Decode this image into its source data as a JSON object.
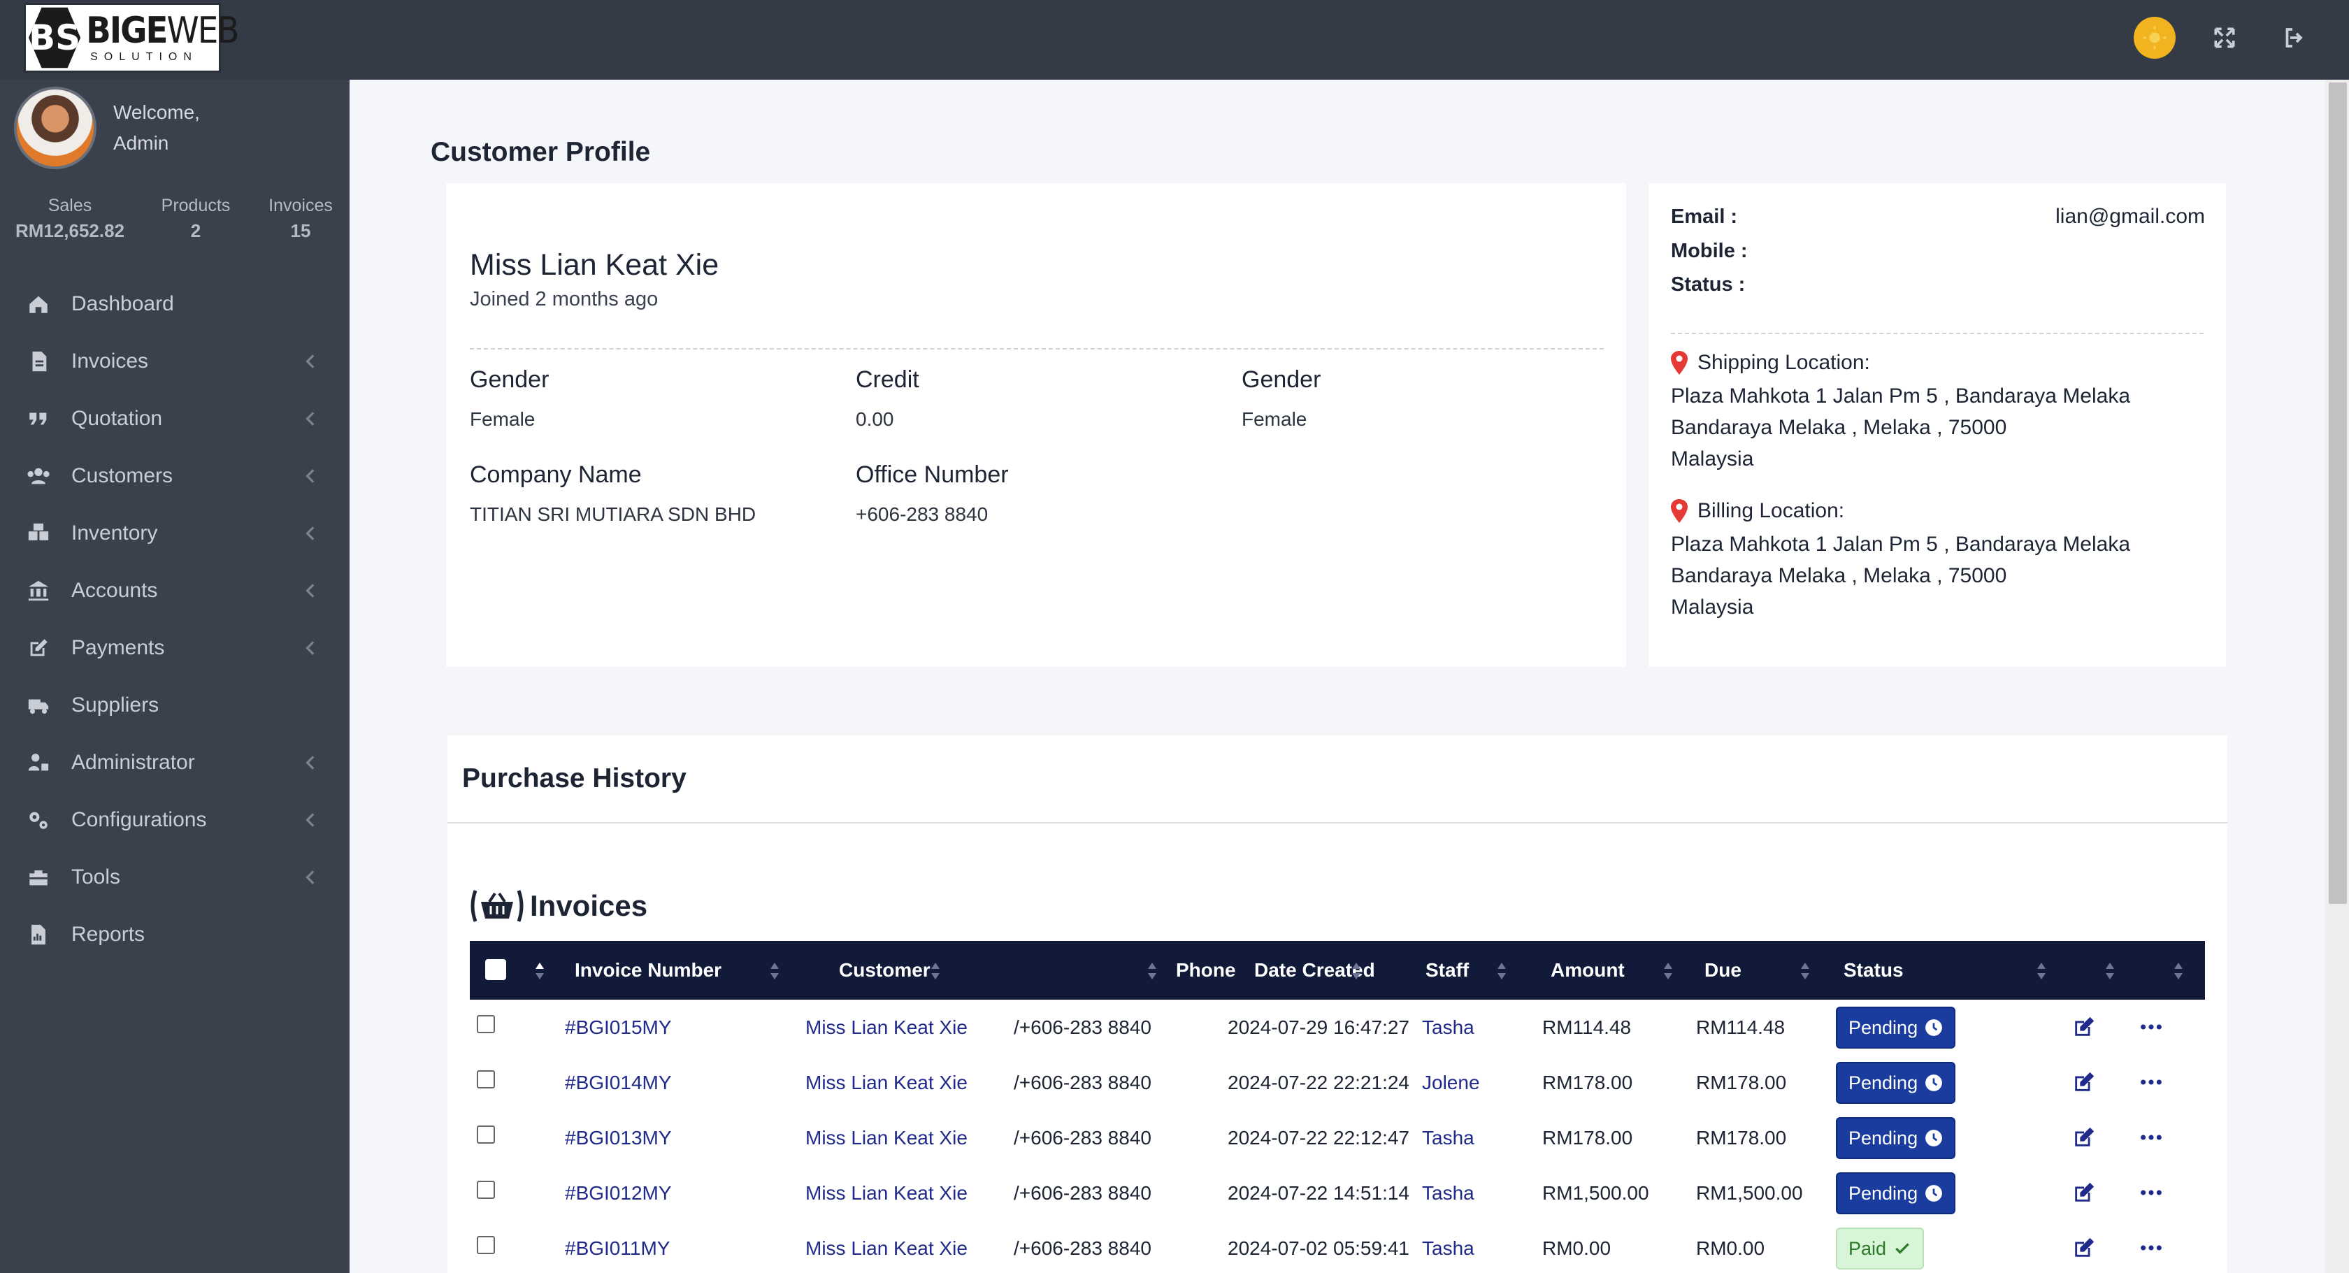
{
  "header": {
    "logo_mark": "BS",
    "logo_brand_bold": "BIGE",
    "logo_brand_light": "WEB",
    "logo_sub": "SOLUTION"
  },
  "user": {
    "welcome": "Welcome,",
    "name": "Admin"
  },
  "stats": [
    {
      "label": "Sales",
      "value": "RM12,652.82"
    },
    {
      "label": "Products",
      "value": "2"
    },
    {
      "label": "Invoices",
      "value": "15"
    }
  ],
  "nav": [
    {
      "label": "Dashboard",
      "icon": "home-icon",
      "has_children": false
    },
    {
      "label": "Invoices",
      "icon": "file-icon",
      "has_children": true
    },
    {
      "label": "Quotation",
      "icon": "quote-icon",
      "has_children": true
    },
    {
      "label": "Customers",
      "icon": "users-icon",
      "has_children": true
    },
    {
      "label": "Inventory",
      "icon": "boxes-icon",
      "has_children": true
    },
    {
      "label": "Accounts",
      "icon": "bank-icon",
      "has_children": true
    },
    {
      "label": "Payments",
      "icon": "edit-icon",
      "has_children": true
    },
    {
      "label": "Suppliers",
      "icon": "truck-icon",
      "has_children": false
    },
    {
      "label": "Administrator",
      "icon": "user-lock-icon",
      "has_children": true
    },
    {
      "label": "Configurations",
      "icon": "cogs-icon",
      "has_children": true
    },
    {
      "label": "Tools",
      "icon": "toolbox-icon",
      "has_children": true
    },
    {
      "label": "Reports",
      "icon": "report-icon",
      "has_children": false
    }
  ],
  "page_title": "Customer Profile",
  "profile": {
    "name": "Miss Lian Keat Xie",
    "joined": "Joined 2 months ago",
    "gender_label": "Gender",
    "gender_value": "Female",
    "credit_label": "Credit",
    "credit_value": "0.00",
    "gender2_label": "Gender",
    "gender2_value": "Female",
    "company_label": "Company Name",
    "company_value": "TITIAN SRI MUTIARA SDN BHD",
    "office_label": "Office Number",
    "office_value": "+606-283 8840"
  },
  "contact": {
    "email_label": "Email :",
    "email_value": "lian@gmail.com",
    "mobile_label": "Mobile :",
    "status_label": "Status :",
    "shipping_label": "Shipping Location:",
    "shipping_lines": [
      "Plaza Mahkota 1 Jalan Pm 5 , Bandaraya Melaka",
      "Bandaraya Melaka , Melaka , 75000",
      "Malaysia"
    ],
    "billing_label": "Billing Location:",
    "billing_lines": [
      "Plaza Mahkota 1 Jalan Pm 5 , Bandaraya Melaka",
      "Bandaraya Melaka , Melaka , 75000",
      "Malaysia"
    ],
    "pin_color": "#e53935"
  },
  "history": {
    "title": "Purchase History",
    "invoices_title": "Invoices",
    "columns": [
      "Invoice Number",
      "Customer",
      "Phone",
      "Date Created",
      "Staff",
      "Amount",
      "Due",
      "Status"
    ],
    "rows": [
      {
        "invoice": "#BGI015MY",
        "customer": "Miss Lian Keat Xie",
        "phone": "/+606-283 8840",
        "date": "2024-07-29 16:47:27",
        "staff": "Tasha",
        "amount": "RM114.48",
        "due": "RM114.48",
        "status": "Pending",
        "status_type": "pending"
      },
      {
        "invoice": "#BGI014MY",
        "customer": "Miss Lian Keat Xie",
        "phone": "/+606-283 8840",
        "date": "2024-07-22 22:21:24",
        "staff": "Jolene",
        "amount": "RM178.00",
        "due": "RM178.00",
        "status": "Pending",
        "status_type": "pending"
      },
      {
        "invoice": "#BGI013MY",
        "customer": "Miss Lian Keat Xie",
        "phone": "/+606-283 8840",
        "date": "2024-07-22 22:12:47",
        "staff": "Tasha",
        "amount": "RM178.00",
        "due": "RM178.00",
        "status": "Pending",
        "status_type": "pending"
      },
      {
        "invoice": "#BGI012MY",
        "customer": "Miss Lian Keat Xie",
        "phone": "/+606-283 8840",
        "date": "2024-07-22 14:51:14",
        "staff": "Tasha",
        "amount": "RM1,500.00",
        "due": "RM1,500.00",
        "status": "Pending",
        "status_type": "pending"
      },
      {
        "invoice": "#BGI011MY",
        "customer": "Miss Lian Keat Xie",
        "phone": "/+606-283 8840",
        "date": "2024-07-02 05:59:41",
        "staff": "Tasha",
        "amount": "RM0.00",
        "due": "RM0.00",
        "status": "Paid",
        "status_type": "paid"
      }
    ]
  },
  "colors": {
    "topbar": "#343a46",
    "sidebar": "#3a404c",
    "table_header": "#121a3a",
    "pending": "#1a3c9e",
    "paid_bg": "#d8f5d8",
    "link": "#1f2a8a"
  }
}
